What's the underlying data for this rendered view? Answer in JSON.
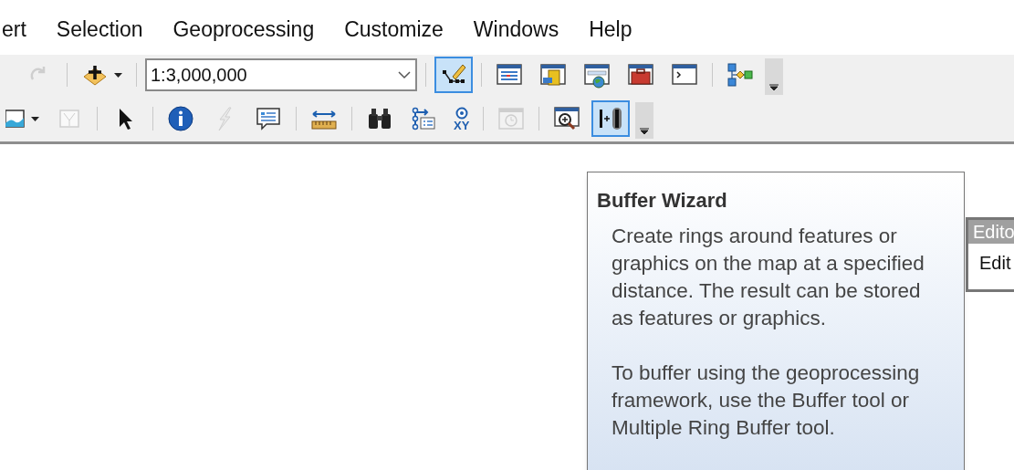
{
  "menu_bar": {
    "items": [
      "ert",
      "Selection",
      "Geoprocessing",
      "Customize",
      "Windows",
      "Help"
    ]
  },
  "toolbar_1": {
    "items": [
      {
        "kind": "redo",
        "disabled": true,
        "selected": false
      },
      {
        "kind": "separator"
      },
      {
        "kind": "add-data",
        "disabled": false,
        "selected": false,
        "dropdown": true
      },
      {
        "kind": "separator"
      },
      {
        "kind": "scale",
        "value": "1:3,000,000"
      },
      {
        "kind": "separator"
      },
      {
        "kind": "editor",
        "disabled": false,
        "selected": true
      },
      {
        "kind": "separator"
      },
      {
        "kind": "table-window",
        "disabled": false,
        "selected": false
      },
      {
        "kind": "catalog",
        "disabled": false,
        "selected": false
      },
      {
        "kind": "globe-window",
        "disabled": false,
        "selected": false
      },
      {
        "kind": "toolbox",
        "disabled": false,
        "selected": false
      },
      {
        "kind": "command-window",
        "disabled": false,
        "selected": false
      },
      {
        "kind": "separator"
      },
      {
        "kind": "model",
        "disabled": false,
        "selected": false
      },
      {
        "kind": "overflow"
      }
    ]
  },
  "toolbar_2": {
    "items": [
      {
        "kind": "map-layer",
        "disabled": false,
        "selected": false,
        "dropdown": true
      },
      {
        "kind": "blank-map",
        "disabled": true,
        "selected": false
      },
      {
        "kind": "separator"
      },
      {
        "kind": "pointer",
        "disabled": false,
        "selected": false
      },
      {
        "kind": "separator"
      },
      {
        "kind": "info",
        "disabled": false,
        "selected": false
      },
      {
        "kind": "lightning",
        "disabled": true,
        "selected": false
      },
      {
        "kind": "popup",
        "disabled": false,
        "selected": false
      },
      {
        "kind": "separator"
      },
      {
        "kind": "measure",
        "disabled": false,
        "selected": false
      },
      {
        "kind": "separator"
      },
      {
        "kind": "binoculars",
        "disabled": false,
        "selected": false
      },
      {
        "kind": "route",
        "disabled": false,
        "selected": false
      },
      {
        "kind": "xy",
        "disabled": false,
        "selected": false,
        "label": "XY"
      },
      {
        "kind": "separator"
      },
      {
        "kind": "clock-window",
        "disabled": true,
        "selected": false
      },
      {
        "kind": "separator"
      },
      {
        "kind": "magnifier",
        "disabled": false,
        "selected": false
      },
      {
        "kind": "buffer",
        "disabled": false,
        "selected": true
      },
      {
        "kind": "overflow"
      }
    ]
  },
  "tooltip": {
    "title": "Buffer Wizard",
    "paragraphs": [
      "Create rings around features or graphics on the map at a specified distance. The result can be stored as features or graphics.",
      "To buffer using the geoprocessing framework, use the Buffer tool or Multiple Ring Buffer tool."
    ]
  },
  "editor_panel": {
    "title": "Edito",
    "item": "Edit"
  }
}
